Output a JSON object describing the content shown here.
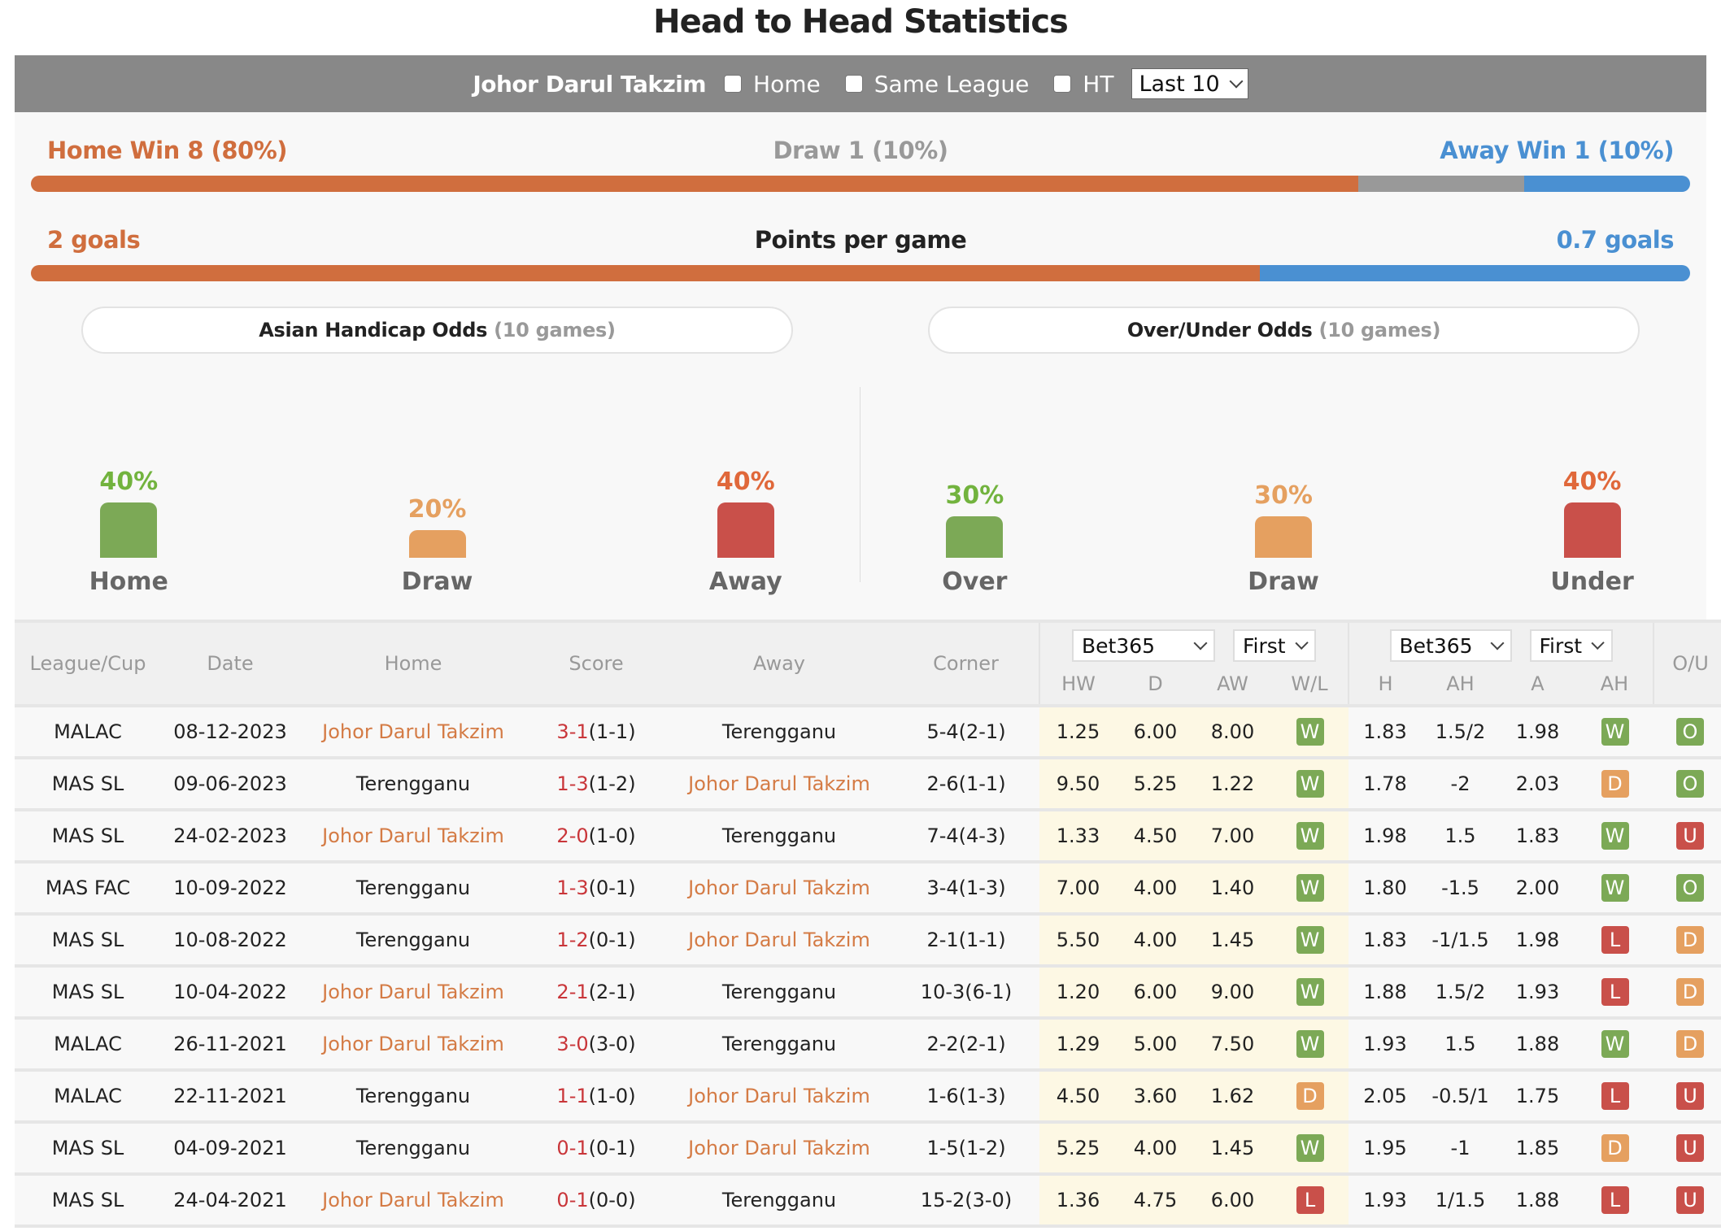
{
  "title": "Head to Head Statistics",
  "filters": {
    "team": "Johor Darul Takzim",
    "home_label": "Home",
    "same_league_label": "Same League",
    "ht_label": "HT",
    "last_select": "Last 10"
  },
  "summary": {
    "home_win": "Home Win 8 (80%)",
    "draw": "Draw 1 (10%)",
    "away_win": "Away Win 1 (10%)",
    "home_win_pct": 80,
    "draw_pct": 10,
    "away_win_pct": 10,
    "home_goals": "2 goals",
    "points_label": "Points per game",
    "away_goals": "0.7 goals",
    "home_goals_value": 2,
    "away_goals_value": 0.7
  },
  "colors": {
    "home": "#d06e3e",
    "draw": "#999999",
    "away": "#4a90d2",
    "green": "#7ca956",
    "orange": "#e5a060",
    "red": "#c9504a"
  },
  "asian_handicap": {
    "title": "Asian Handicap Odds",
    "games": "(10 games)",
    "items": [
      {
        "label": "Home",
        "pct": "40%",
        "value": 40
      },
      {
        "label": "Draw",
        "pct": "20%",
        "value": 20
      },
      {
        "label": "Away",
        "pct": "40%",
        "value": 40
      }
    ]
  },
  "over_under": {
    "title": "Over/Under Odds",
    "games": "(10 games)",
    "items": [
      {
        "label": "Over",
        "pct": "30%",
        "value": 30
      },
      {
        "label": "Draw",
        "pct": "30%",
        "value": 30
      },
      {
        "label": "Under",
        "pct": "40%",
        "value": 40
      }
    ]
  },
  "table": {
    "headers": {
      "league": "League/Cup",
      "date": "Date",
      "home": "Home",
      "score": "Score",
      "away": "Away",
      "corner": "Corner",
      "ou": "O/U"
    },
    "odds1": {
      "bookmaker": "Bet365",
      "type": "First",
      "cols": [
        "HW",
        "D",
        "AW",
        "W/L"
      ]
    },
    "odds2": {
      "bookmaker": "Bet365",
      "type": "First",
      "cols": [
        "H",
        "AH",
        "A",
        "AH"
      ]
    },
    "rows": [
      {
        "league": "MALAC",
        "date": "08-12-2023",
        "home": "Johor Darul Takzim",
        "score": "3-1",
        "ht": "(1-1)",
        "away": "Terengganu",
        "corner": "5-4(2-1)",
        "hw": "1.25",
        "d": "6.00",
        "aw": "8.00",
        "wl": "W",
        "h": "1.83",
        "ah": "1.5/2",
        "a": "1.98",
        "ahr": "W",
        "ou": "O",
        "home_is_jdt": true
      },
      {
        "league": "MAS SL",
        "date": "09-06-2023",
        "home": "Terengganu",
        "score": "1-3",
        "ht": "(1-2)",
        "away": "Johor Darul Takzim",
        "corner": "2-6(1-1)",
        "hw": "9.50",
        "d": "5.25",
        "aw": "1.22",
        "wl": "W",
        "h": "1.78",
        "ah": "-2",
        "a": "2.03",
        "ahr": "D",
        "ou": "O",
        "home_is_jdt": false
      },
      {
        "league": "MAS SL",
        "date": "24-02-2023",
        "home": "Johor Darul Takzim",
        "score": "2-0",
        "ht": "(1-0)",
        "away": "Terengganu",
        "corner": "7-4(4-3)",
        "hw": "1.33",
        "d": "4.50",
        "aw": "7.00",
        "wl": "W",
        "h": "1.98",
        "ah": "1.5",
        "a": "1.83",
        "ahr": "W",
        "ou": "U",
        "home_is_jdt": true
      },
      {
        "league": "MAS FAC",
        "date": "10-09-2022",
        "home": "Terengganu",
        "score": "1-3",
        "ht": "(0-1)",
        "away": "Johor Darul Takzim",
        "corner": "3-4(1-3)",
        "hw": "7.00",
        "d": "4.00",
        "aw": "1.40",
        "wl": "W",
        "h": "1.80",
        "ah": "-1.5",
        "a": "2.00",
        "ahr": "W",
        "ou": "O",
        "home_is_jdt": false
      },
      {
        "league": "MAS SL",
        "date": "10-08-2022",
        "home": "Terengganu",
        "score": "1-2",
        "ht": "(0-1)",
        "away": "Johor Darul Takzim",
        "corner": "2-1(1-1)",
        "hw": "5.50",
        "d": "4.00",
        "aw": "1.45",
        "wl": "W",
        "h": "1.83",
        "ah": "-1/1.5",
        "a": "1.98",
        "ahr": "L",
        "ou": "D",
        "home_is_jdt": false
      },
      {
        "league": "MAS SL",
        "date": "10-04-2022",
        "home": "Johor Darul Takzim",
        "score": "2-1",
        "ht": "(2-1)",
        "away": "Terengganu",
        "corner": "10-3(6-1)",
        "hw": "1.20",
        "d": "6.00",
        "aw": "9.00",
        "wl": "W",
        "h": "1.88",
        "ah": "1.5/2",
        "a": "1.93",
        "ahr": "L",
        "ou": "D",
        "home_is_jdt": true
      },
      {
        "league": "MALAC",
        "date": "26-11-2021",
        "home": "Johor Darul Takzim",
        "score": "3-0",
        "ht": "(3-0)",
        "away": "Terengganu",
        "corner": "2-2(2-1)",
        "hw": "1.29",
        "d": "5.00",
        "aw": "7.50",
        "wl": "W",
        "h": "1.93",
        "ah": "1.5",
        "a": "1.88",
        "ahr": "W",
        "ou": "D",
        "home_is_jdt": true
      },
      {
        "league": "MALAC",
        "date": "22-11-2021",
        "home": "Terengganu",
        "score": "1-1",
        "ht": "(1-0)",
        "away": "Johor Darul Takzim",
        "corner": "1-6(1-3)",
        "hw": "4.50",
        "d": "3.60",
        "aw": "1.62",
        "wl": "D",
        "h": "2.05",
        "ah": "-0.5/1",
        "a": "1.75",
        "ahr": "L",
        "ou": "U",
        "home_is_jdt": false
      },
      {
        "league": "MAS SL",
        "date": "04-09-2021",
        "home": "Terengganu",
        "score": "0-1",
        "ht": "(0-1)",
        "away": "Johor Darul Takzim",
        "corner": "1-5(1-2)",
        "hw": "5.25",
        "d": "4.00",
        "aw": "1.45",
        "wl": "W",
        "h": "1.95",
        "ah": "-1",
        "a": "1.85",
        "ahr": "D",
        "ou": "U",
        "home_is_jdt": false
      },
      {
        "league": "MAS SL",
        "date": "24-04-2021",
        "home": "Johor Darul Takzim",
        "score": "0-1",
        "ht": "(0-0)",
        "away": "Terengganu",
        "corner": "15-2(3-0)",
        "hw": "1.36",
        "d": "4.75",
        "aw": "6.00",
        "wl": "L",
        "h": "1.93",
        "ah": "1/1.5",
        "a": "1.88",
        "ahr": "L",
        "ou": "U",
        "home_is_jdt": true
      }
    ]
  }
}
